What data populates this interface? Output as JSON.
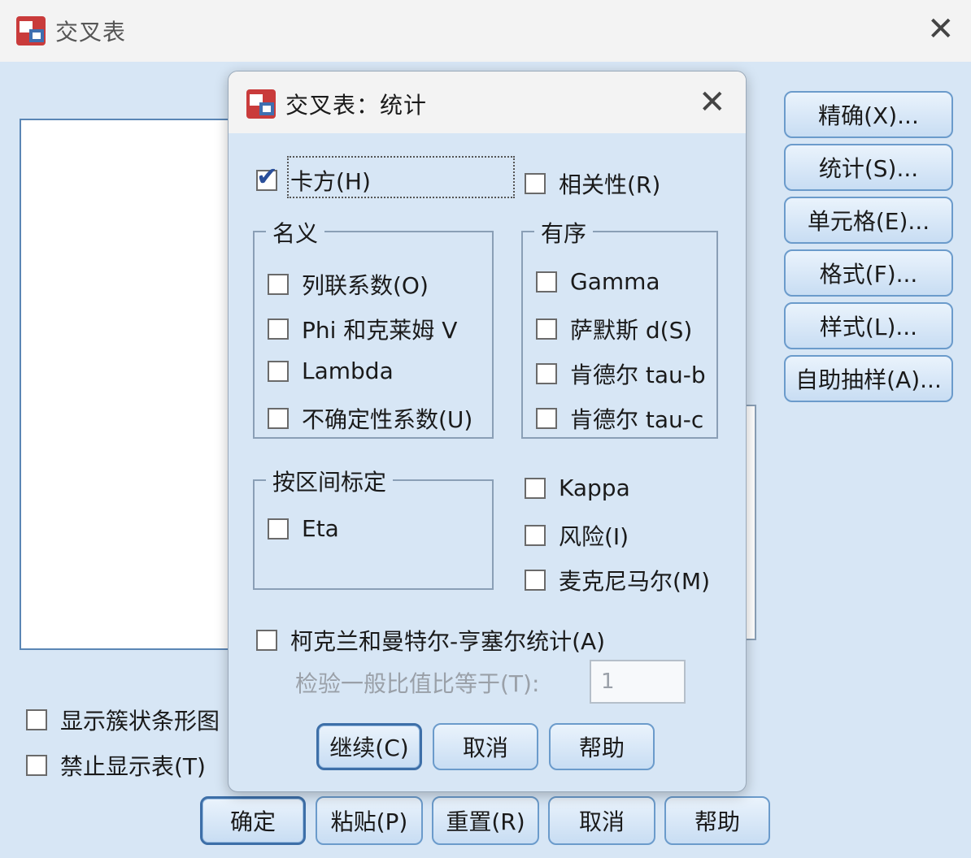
{
  "parent": {
    "title": "交叉表",
    "side_buttons": [
      "精确(X)...",
      "统计(S)...",
      "单元格(E)...",
      "格式(F)...",
      "样式(L)...",
      "自助抽样(A)..."
    ],
    "checkboxes": [
      {
        "label": "显示簇状条形图",
        "checked": false
      },
      {
        "label": "禁止显示表(T)",
        "checked": false
      }
    ],
    "bottom_buttons": [
      "确定",
      "粘贴(P)",
      "重置(R)",
      "取消",
      "帮助"
    ]
  },
  "dialog": {
    "title": "交叉表：统计",
    "chi_square": {
      "label": "卡方(H)",
      "checked": true
    },
    "correlations": {
      "label": "相关性(R)",
      "checked": false
    },
    "nominal": {
      "legend": "名义",
      "items": [
        {
          "label": "列联系数(O)",
          "checked": false
        },
        {
          "label": "Phi 和克莱姆 V",
          "checked": false
        },
        {
          "label": "Lambda",
          "checked": false
        },
        {
          "label": "不确定性系数(U)",
          "checked": false
        }
      ]
    },
    "ordinal": {
      "legend": "有序",
      "items": [
        {
          "label": "Gamma",
          "checked": false
        },
        {
          "label": "萨默斯 d(S)",
          "checked": false
        },
        {
          "label": "肯德尔 tau-b",
          "checked": false
        },
        {
          "label": "肯德尔 tau-c",
          "checked": false
        }
      ]
    },
    "interval": {
      "legend": "按区间标定",
      "items": [
        {
          "label": "Eta",
          "checked": false
        }
      ]
    },
    "others": [
      {
        "label": "Kappa",
        "checked": false
      },
      {
        "label": "风险(I)",
        "checked": false
      },
      {
        "label": "麦克尼马尔(M)",
        "checked": false
      }
    ],
    "cmh": {
      "label": "柯克兰和曼特尔-亨塞尔统计(A)",
      "checked": false
    },
    "odds_ratio": {
      "label": "检验一般比值比等于(T):",
      "value": "1"
    },
    "buttons": {
      "continue": "继续(C)",
      "cancel": "取消",
      "help": "帮助"
    }
  },
  "colors": {
    "window_bg": "#d7e6f5",
    "titlebar_bg": "#f3f3f3",
    "button_border": "#6b9bcb",
    "check_tick": "#2a4f9a"
  }
}
